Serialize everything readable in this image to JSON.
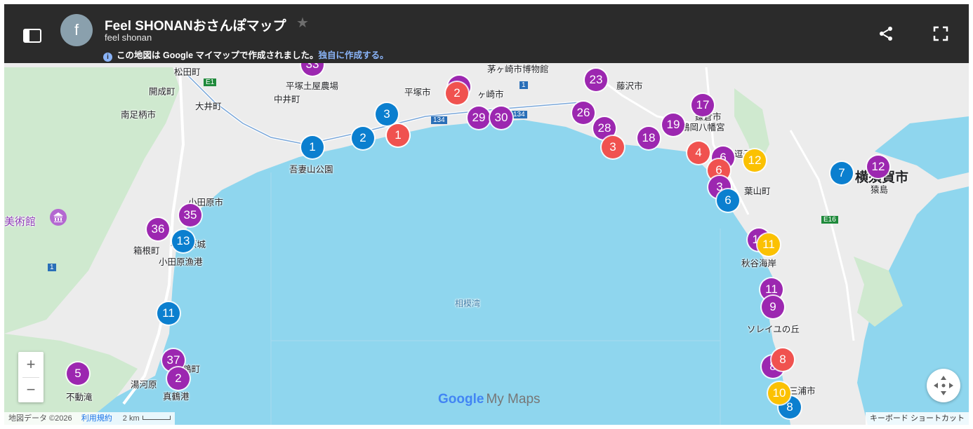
{
  "header": {
    "title": "Feel SHONANおさんぽマップ",
    "subtitle": "feel shonan",
    "avatar_letter": "f",
    "notice": "この地図は Google マイマップで作成されました。",
    "notice_link": "独自に作成する。",
    "star_glyph": "★"
  },
  "icons": {
    "sidebar": "sidebar-toggle-icon",
    "share": "share-icon",
    "fullscreen": "fullscreen-icon",
    "info": "info-icon",
    "compass": "compass-icon",
    "museum": "museum-icon"
  },
  "colors": {
    "purple": "#9c27b0",
    "blue": "#0b7fcf",
    "red": "#f0524f",
    "yellow": "#fbc102",
    "water": "#8fd6ee",
    "land": "#ececec",
    "green": "#cfe9cf",
    "header": "#2b2b2b"
  },
  "place_labels": [
    "松田町",
    "開成町",
    "大井町",
    "南足柄市",
    "平塚土屋農場",
    "中井町",
    "平塚市",
    "茅ヶ崎市博物館",
    "ヶ崎市",
    "藤沢市",
    "吾妻山公園",
    "小田原市",
    "美術館",
    "箱根町",
    "小田原城",
    "小田原漁港",
    "湯河原",
    "鶴町",
    "不動滝",
    "真鶴港",
    "相模湾",
    "鎌倉市",
    "鶴岡八幡宮",
    "逗子市",
    "葉山町",
    "横須賀市",
    "猿島",
    "秋谷海岸",
    "ソレイユの丘",
    "三浦市"
  ],
  "road_labels": [
    "E1",
    "134",
    "1",
    "134",
    "1",
    "E16"
  ],
  "markers": [
    "33",
    "1",
    "2",
    "3",
    "1",
    "3",
    "2",
    "1",
    "2",
    "29",
    "30",
    "23",
    "26",
    "28",
    "3",
    "18",
    "17",
    "19",
    "4",
    "6",
    "6",
    "12",
    "3",
    "6",
    "7",
    "12",
    "36",
    "35",
    "13",
    "11",
    "37",
    "2",
    "5",
    "13",
    "11",
    "11",
    "9",
    "8",
    "8",
    "10",
    "8"
  ],
  "controls": {
    "zoom_in": "+",
    "zoom_out": "−"
  },
  "footer": {
    "map_data": "地図データ ©2026",
    "terms": "利用規約",
    "scale": "2 km",
    "shortcuts": "キーボード ショートカット"
  },
  "logo": {
    "google": "Google",
    "product": "My Maps"
  }
}
